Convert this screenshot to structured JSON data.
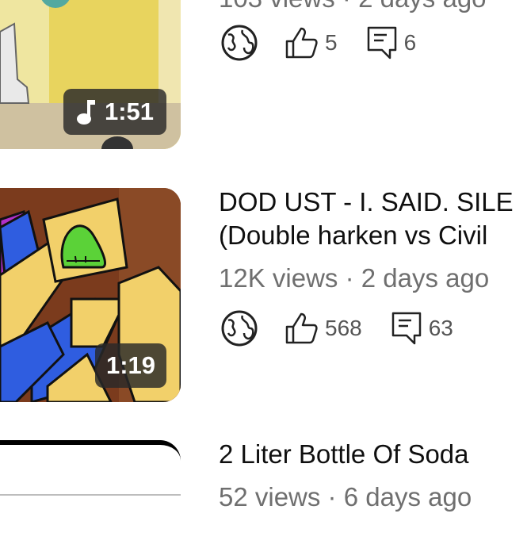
{
  "videos": [
    {
      "meta": "103 views · 2 days ago",
      "duration": "1:51",
      "likes": "5",
      "comments": "6"
    },
    {
      "title_line1": "DOD UST - I. SAID. SILE",
      "title_line2": "(Double harken vs Civil",
      "meta": "12K views · 2 days ago",
      "duration": "1:19",
      "likes": "568",
      "comments": "63"
    },
    {
      "title_line1": "2 Liter Bottle Of Soda",
      "meta": "52 views · 6 days ago"
    }
  ],
  "icons": {
    "visibility": "globe-icon",
    "likes": "thumbs-up-icon",
    "comments": "comment-icon",
    "audio": "music-note-icon"
  }
}
